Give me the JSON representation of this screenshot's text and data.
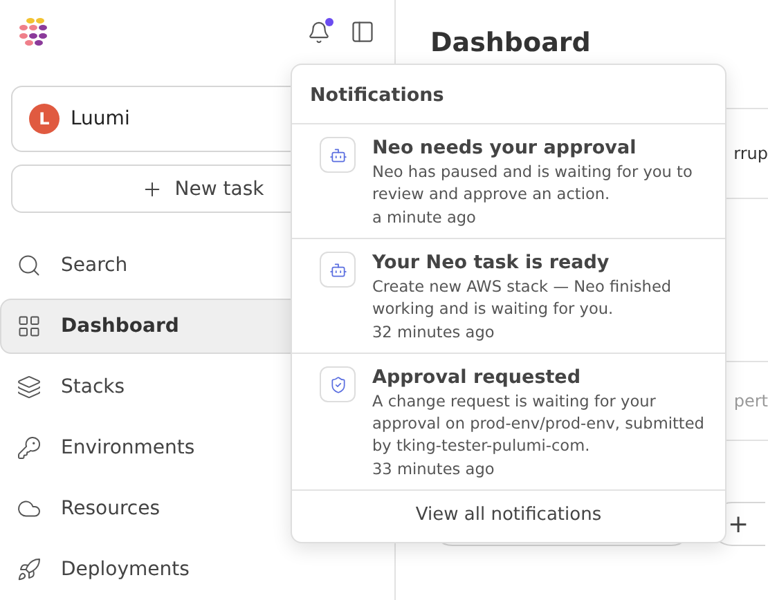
{
  "sidebar": {
    "org": {
      "initial": "L",
      "name": "Luumi"
    },
    "notifications_unread": true,
    "new_task": "New task",
    "items": [
      {
        "label": "Search",
        "selected": false
      },
      {
        "label": "Dashboard",
        "selected": true
      },
      {
        "label": "Stacks",
        "selected": false
      },
      {
        "label": "Environments",
        "selected": false
      },
      {
        "label": "Resources",
        "selected": false
      },
      {
        "label": "Deployments",
        "selected": false
      }
    ]
  },
  "main": {
    "title": "Dashboard",
    "fragment_1": "rrup",
    "fragment_2": "pert",
    "add_button": "+"
  },
  "notifications": {
    "title": "Notifications",
    "items": [
      {
        "kind": "bot",
        "title": "Neo needs your approval",
        "body": "Neo has paused and is waiting for you to review and approve an action.",
        "time": "a minute ago"
      },
      {
        "kind": "bot",
        "title": "Your Neo task is ready",
        "body": "Create new AWS stack — Neo finished working and is waiting for you.",
        "time": "32 minutes ago"
      },
      {
        "kind": "shield",
        "title": "Approval requested",
        "body": "A change request is waiting for your approval on prod-env/prod-env, submitted by tking-tester-pulumi-com.",
        "time": "33 minutes ago"
      }
    ],
    "footer": "View all notifications"
  }
}
